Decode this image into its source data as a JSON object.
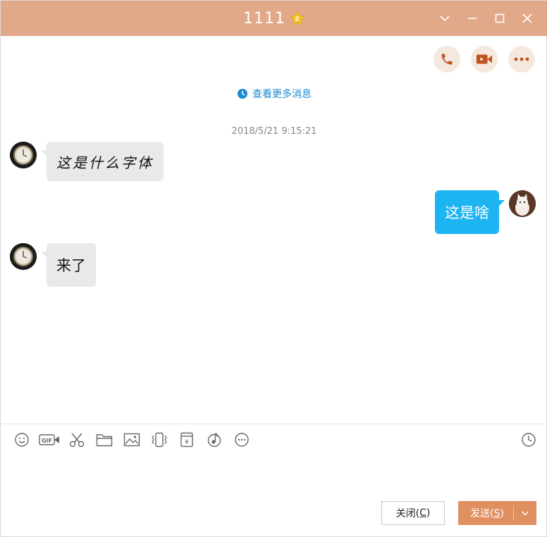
{
  "window": {
    "title": "1111",
    "colors": {
      "titlebar": "#e1a88a",
      "accent": "#e09060",
      "bubble_self": "#1db4f2",
      "bubble_other": "#e9e9e9",
      "link": "#1a8ad4"
    }
  },
  "header": {
    "actions": [
      {
        "icon": "phone-icon"
      },
      {
        "icon": "video-camera-icon"
      },
      {
        "icon": "more-icon"
      }
    ]
  },
  "chat": {
    "view_more": "查看更多消息",
    "timestamp": "2018/5/21 9:15:21",
    "messages": [
      {
        "sender": "other",
        "text": "这是什么字体"
      },
      {
        "sender": "self",
        "text": "这是啥"
      },
      {
        "sender": "other",
        "text": "来了"
      }
    ]
  },
  "toolbar": {
    "tools": [
      "emoji-icon",
      "gif-icon",
      "scissors-icon",
      "folder-icon",
      "image-icon",
      "shake-icon",
      "red-packet-icon",
      "music-icon",
      "more-circle-icon"
    ],
    "history": "clock-icon"
  },
  "footer": {
    "close_label": "关闭(",
    "close_key": "C",
    "close_suffix": ")",
    "send_label": "发送(",
    "send_key": "S",
    "send_suffix": ")"
  }
}
